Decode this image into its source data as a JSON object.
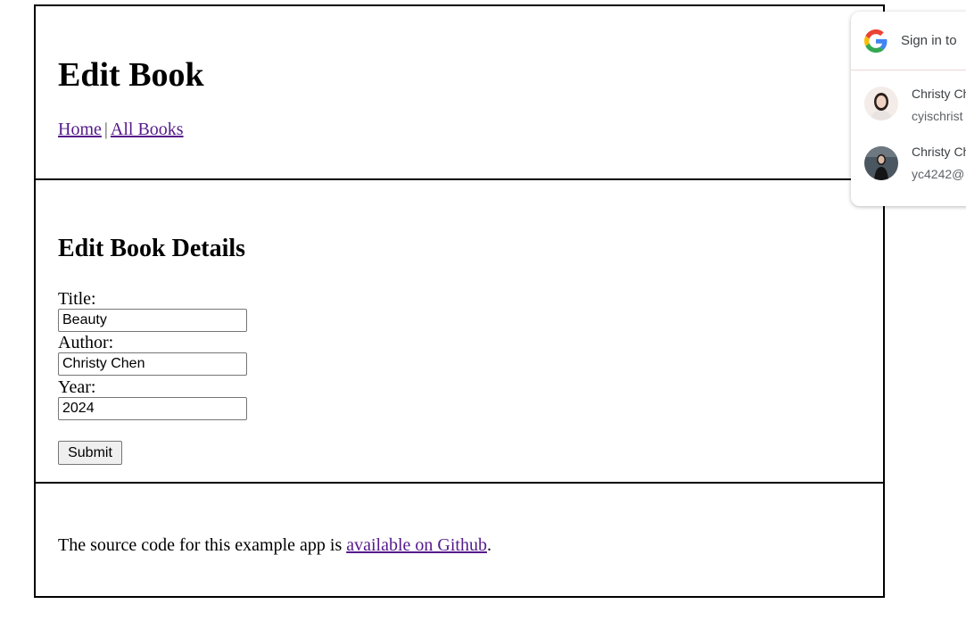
{
  "header": {
    "title": "Edit Book",
    "nav": {
      "home_label": "Home",
      "separator": "|",
      "all_books_label": "All Books"
    }
  },
  "form": {
    "heading": "Edit Book Details",
    "title_label": "Title:",
    "title_value": "Beauty",
    "author_label": "Author:",
    "author_value": "Christy Chen",
    "year_label": "Year:",
    "year_value": "2024",
    "submit_label": "Submit"
  },
  "footer": {
    "text_before": "The source code for this example app is ",
    "link_label": "available on Github",
    "text_after": "."
  },
  "google_popup": {
    "title": "Sign in to",
    "accounts": [
      {
        "name": "Christy Ch",
        "email": "cyischrist"
      },
      {
        "name": "Christy Ch",
        "email": "yc4242@"
      }
    ]
  },
  "colors": {
    "link": "#551a8b",
    "border": "#000000",
    "popup_divider": "#f0d6d6"
  }
}
